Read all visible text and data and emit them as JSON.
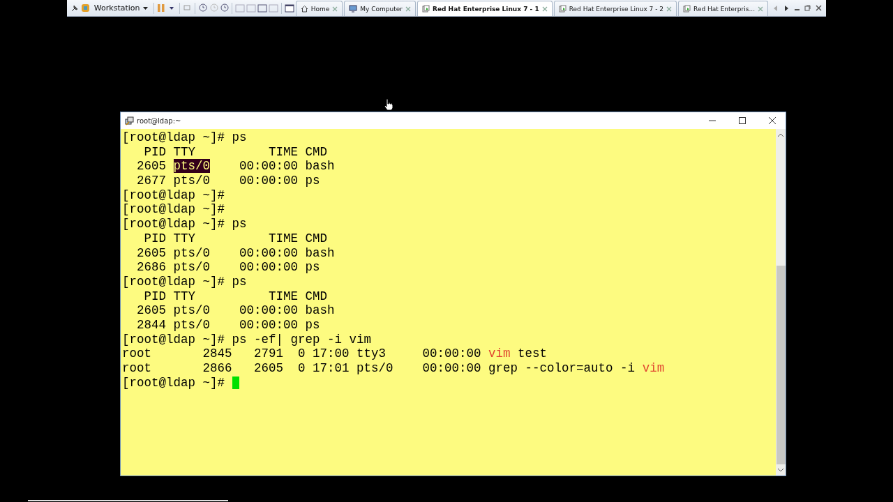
{
  "toolbar": {
    "menu": "Workstation",
    "tabs": [
      {
        "label": "Home",
        "selected": false,
        "kind": "home"
      },
      {
        "label": "My Computer",
        "selected": false,
        "kind": "computer"
      },
      {
        "label": "Red Hat Enterprise Linux 7 - 1",
        "selected": true,
        "kind": "vm"
      },
      {
        "label": "Red Hat Enterprise Linux 7 - 2",
        "selected": false,
        "kind": "vm"
      },
      {
        "label": "Red Hat Enterpris...",
        "selected": false,
        "kind": "vm"
      }
    ]
  },
  "terminal": {
    "title": "root@ldap:~",
    "lines": [
      {
        "cursor": false,
        "segments": [
          {
            "text": "[root@ldap ~]# ps",
            "kind": "plain"
          }
        ]
      },
      {
        "cursor": false,
        "segments": [
          {
            "text": "   PID TTY          TIME CMD",
            "kind": "plain"
          }
        ]
      },
      {
        "cursor": false,
        "segments": [
          {
            "text": "  2605 ",
            "kind": "plain"
          },
          {
            "text": "pts/0",
            "kind": "highlight"
          },
          {
            "text": "    00:00:00 bash",
            "kind": "plain"
          }
        ]
      },
      {
        "cursor": false,
        "segments": [
          {
            "text": "  2677 pts/0    00:00:00 ps",
            "kind": "plain"
          }
        ]
      },
      {
        "cursor": false,
        "segments": [
          {
            "text": "[root@ldap ~]#",
            "kind": "plain"
          }
        ]
      },
      {
        "cursor": false,
        "segments": [
          {
            "text": "[root@ldap ~]#",
            "kind": "plain"
          }
        ]
      },
      {
        "cursor": false,
        "segments": [
          {
            "text": "[root@ldap ~]# ps",
            "kind": "plain"
          }
        ]
      },
      {
        "cursor": false,
        "segments": [
          {
            "text": "   PID TTY          TIME CMD",
            "kind": "plain"
          }
        ]
      },
      {
        "cursor": false,
        "segments": [
          {
            "text": "  2605 pts/0    00:00:00 bash",
            "kind": "plain"
          }
        ]
      },
      {
        "cursor": false,
        "segments": [
          {
            "text": "  2686 pts/0    00:00:00 ps",
            "kind": "plain"
          }
        ]
      },
      {
        "cursor": false,
        "segments": [
          {
            "text": "[root@ldap ~]# ps",
            "kind": "plain"
          }
        ]
      },
      {
        "cursor": false,
        "segments": [
          {
            "text": "   PID TTY          TIME CMD",
            "kind": "plain"
          }
        ]
      },
      {
        "cursor": false,
        "segments": [
          {
            "text": "  2605 pts/0    00:00:00 bash",
            "kind": "plain"
          }
        ]
      },
      {
        "cursor": false,
        "segments": [
          {
            "text": "  2844 pts/0    00:00:00 ps",
            "kind": "plain"
          }
        ]
      },
      {
        "cursor": false,
        "segments": [
          {
            "text": "[root@ldap ~]# ps -ef| grep -i vim",
            "kind": "plain"
          }
        ]
      },
      {
        "cursor": false,
        "segments": [
          {
            "text": "root       2845   2791  0 17:00 tty3     00:00:00 ",
            "kind": "plain"
          },
          {
            "text": "vim",
            "kind": "match"
          },
          {
            "text": " test",
            "kind": "plain"
          }
        ]
      },
      {
        "cursor": false,
        "segments": [
          {
            "text": "root       2866   2605  0 17:01 pts/0    00:00:00 grep --color=auto -i ",
            "kind": "plain"
          },
          {
            "text": "vim",
            "kind": "match"
          }
        ]
      },
      {
        "cursor": true,
        "segments": [
          {
            "text": "[root@ldap ~]# ",
            "kind": "plain"
          }
        ]
      }
    ]
  }
}
